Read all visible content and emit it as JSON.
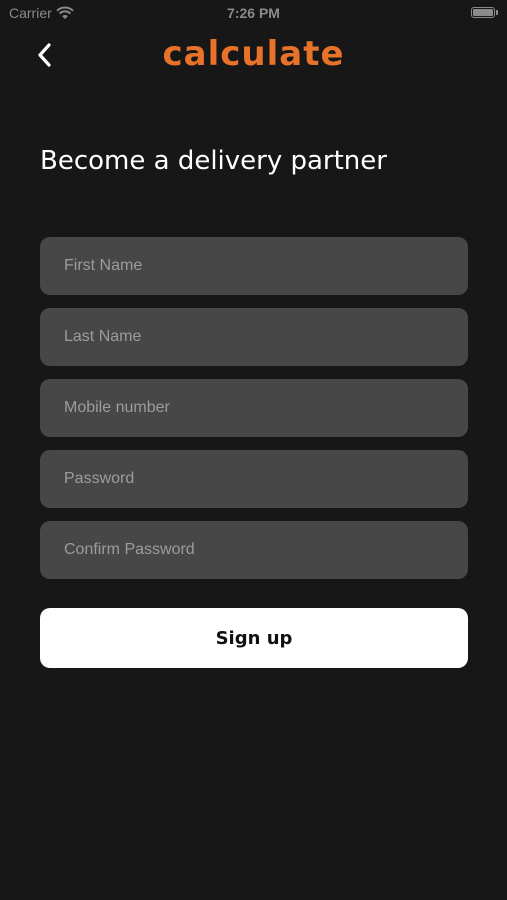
{
  "status_bar": {
    "carrier": "Carrier",
    "time": "7:26 PM",
    "wifi_icon": "wifi-icon",
    "battery_icon": "battery-icon"
  },
  "nav": {
    "back_icon": "chevron-left-icon",
    "brand": "calculate",
    "brand_color": "#e8722a"
  },
  "page": {
    "title": "Become a delivery partner"
  },
  "form": {
    "first_name": {
      "placeholder": "First Name",
      "value": ""
    },
    "last_name": {
      "placeholder": "Last Name",
      "value": ""
    },
    "mobile": {
      "placeholder": "Mobile number",
      "value": ""
    },
    "password": {
      "placeholder": "Password",
      "value": ""
    },
    "confirm_password": {
      "placeholder": "Confirm Password",
      "value": ""
    },
    "submit_label": "Sign up"
  },
  "colors": {
    "background": "#171717",
    "field_background": "#474747",
    "button_background": "#ffffff"
  }
}
